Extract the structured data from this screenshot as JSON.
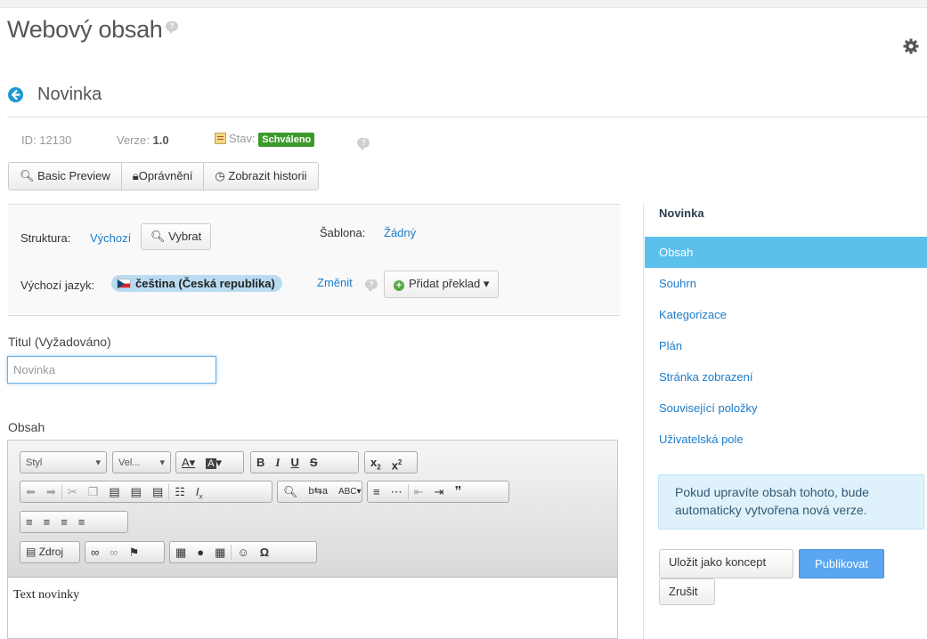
{
  "header": {
    "title": "Webový obsah",
    "help_icon": "question-bubble-icon",
    "settings_icon": "gear-icon"
  },
  "article": {
    "back_icon": "back-arrow-icon",
    "title": "Novinka",
    "id_label": "ID:",
    "id_value": "12130",
    "version_label": "Verze:",
    "version_value": "1.0",
    "status_label": "Stav:",
    "status_value": "Schváleno",
    "status_color": "#3c9a2b"
  },
  "toolbar": {
    "basic_preview": "Basic Preview",
    "permissions": "Oprávnění",
    "history": "Zobrazit historii"
  },
  "structure": {
    "structure_label": "Struktura:",
    "structure_value": "Výchozí",
    "select_button": "Vybrat",
    "template_label": "Šablona:",
    "template_value": "Žádný",
    "language_label": "Výchozí jazyk:",
    "language_value": "čeština (Česká republika)",
    "change_link": "Změnit",
    "add_translation": "Přidat překlad"
  },
  "form": {
    "title_label": "Titul (Vyžadováno)",
    "title_value": "Novinka",
    "content_label": "Obsah"
  },
  "editor": {
    "style_combo": "Styl",
    "size_combo": "Vel...",
    "source_button": "Zdroj",
    "body_text": "Text novinky"
  },
  "sidebar": {
    "heading": "Novinka",
    "items": [
      {
        "label": "Obsah",
        "active": true
      },
      {
        "label": "Souhrn"
      },
      {
        "label": "Kategorizace"
      },
      {
        "label": "Plán"
      },
      {
        "label": "Stránka zobrazení"
      },
      {
        "label": "Související položky"
      },
      {
        "label": "Uživatelská pole"
      }
    ],
    "info_text": "Pokud upravíte obsah tohoto, bude automaticky vytvořena nová verze.",
    "save_draft": "Uložit jako koncept",
    "publish": "Publikovat",
    "cancel": "Zrušit",
    "accent_color": "#5bc0eb"
  }
}
